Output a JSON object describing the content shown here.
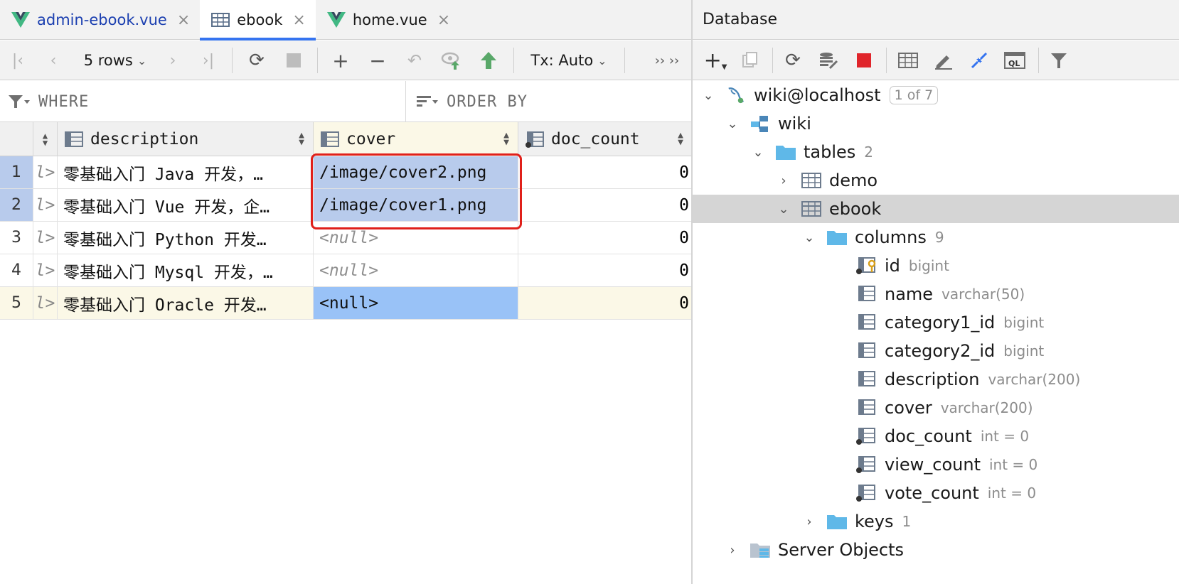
{
  "editor": {
    "tabs": [
      {
        "label": "admin-ebook.vue",
        "icon": "vue-icon",
        "active": false
      },
      {
        "label": "ebook",
        "icon": "table-icon",
        "active": true
      },
      {
        "label": "home.vue",
        "icon": "vue-icon",
        "active": false
      }
    ],
    "close_glyph": "×"
  },
  "toolbar": {
    "rows_label": "5 rows",
    "tx_label": "Tx: Auto",
    "more_glyph": "›› ››"
  },
  "filter": {
    "where_label": "WHERE",
    "order_label": "ORDER BY"
  },
  "grid": {
    "columns": [
      {
        "name": "description"
      },
      {
        "name": "cover"
      },
      {
        "name": "doc_count"
      }
    ],
    "truncated_prev": "l>",
    "rows": [
      {
        "num": "1",
        "description": "零基础入门 Java 开发，…",
        "cover": "/image/cover2.png",
        "doc_count": "0"
      },
      {
        "num": "2",
        "description": "零基础入门 Vue 开发，企…",
        "cover": "/image/cover1.png",
        "doc_count": "0"
      },
      {
        "num": "3",
        "description": "零基础入门 Python 开发…",
        "cover": "<null>",
        "doc_count": "0"
      },
      {
        "num": "4",
        "description": "零基础入门 Mysql 开发，…",
        "cover": "<null>",
        "doc_count": "0"
      },
      {
        "num": "5",
        "description": "零基础入门 Oracle 开发…",
        "cover": "<null>",
        "doc_count": "0"
      }
    ]
  },
  "database": {
    "title": "Database",
    "connection": {
      "label": "wiki@localhost",
      "badge": "1 of 7"
    },
    "schema": "wiki",
    "tables": {
      "label": "tables",
      "count": "2"
    },
    "table_demo": "demo",
    "table_ebook": "ebook",
    "columns_folder": {
      "label": "columns",
      "count": "9"
    },
    "columns": [
      {
        "name": "id",
        "type": "bigint"
      },
      {
        "name": "name",
        "type": "varchar(50)"
      },
      {
        "name": "category1_id",
        "type": "bigint"
      },
      {
        "name": "category2_id",
        "type": "bigint"
      },
      {
        "name": "description",
        "type": "varchar(200)"
      },
      {
        "name": "cover",
        "type": "varchar(200)"
      },
      {
        "name": "doc_count",
        "type": "int = 0"
      },
      {
        "name": "view_count",
        "type": "int = 0"
      },
      {
        "name": "vote_count",
        "type": "int = 0"
      }
    ],
    "keys": {
      "label": "keys",
      "count": "1"
    },
    "server_objects": "Server Objects"
  },
  "colors": {
    "accent": "#3574f0",
    "selection": "#b8cbec",
    "current_cell": "#99c2f7",
    "highlight_box": "#e0201a",
    "folder": "#5fb8e8"
  }
}
